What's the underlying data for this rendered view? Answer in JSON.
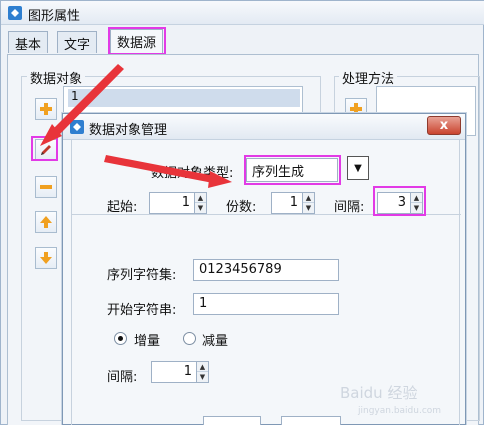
{
  "window": {
    "title": "图形属性"
  },
  "tabs": [
    {
      "label": "基本"
    },
    {
      "label": "文字"
    },
    {
      "label": "数据源"
    }
  ],
  "groups": {
    "data_objects": "数据对象",
    "processing": "处理方法"
  },
  "data_list": {
    "items": [
      "1"
    ]
  },
  "dialog": {
    "title": "数据对象管理",
    "close_label": "x",
    "type_label": "数据对象类型:",
    "type_value": "序列生成",
    "start_label": "起始:",
    "start_value": "1",
    "copies_label": "份数:",
    "copies_value": "1",
    "interval_label": "间隔:",
    "interval_value": "3",
    "charset_label": "序列字符集:",
    "charset_value": "0123456789",
    "start_string_label": "开始字符串:",
    "start_string_value": "1",
    "increase_label": "增量",
    "decrease_label": "减量",
    "step_label": "间隔:",
    "step_value": "1",
    "increase_selected": true
  },
  "watermark": {
    "text": "Baidu 经验",
    "sub": "jingyan.baidu.com"
  },
  "colors": {
    "highlight": "#e23ae6",
    "arrow": "#e8343a",
    "accent": "#f0a020"
  }
}
